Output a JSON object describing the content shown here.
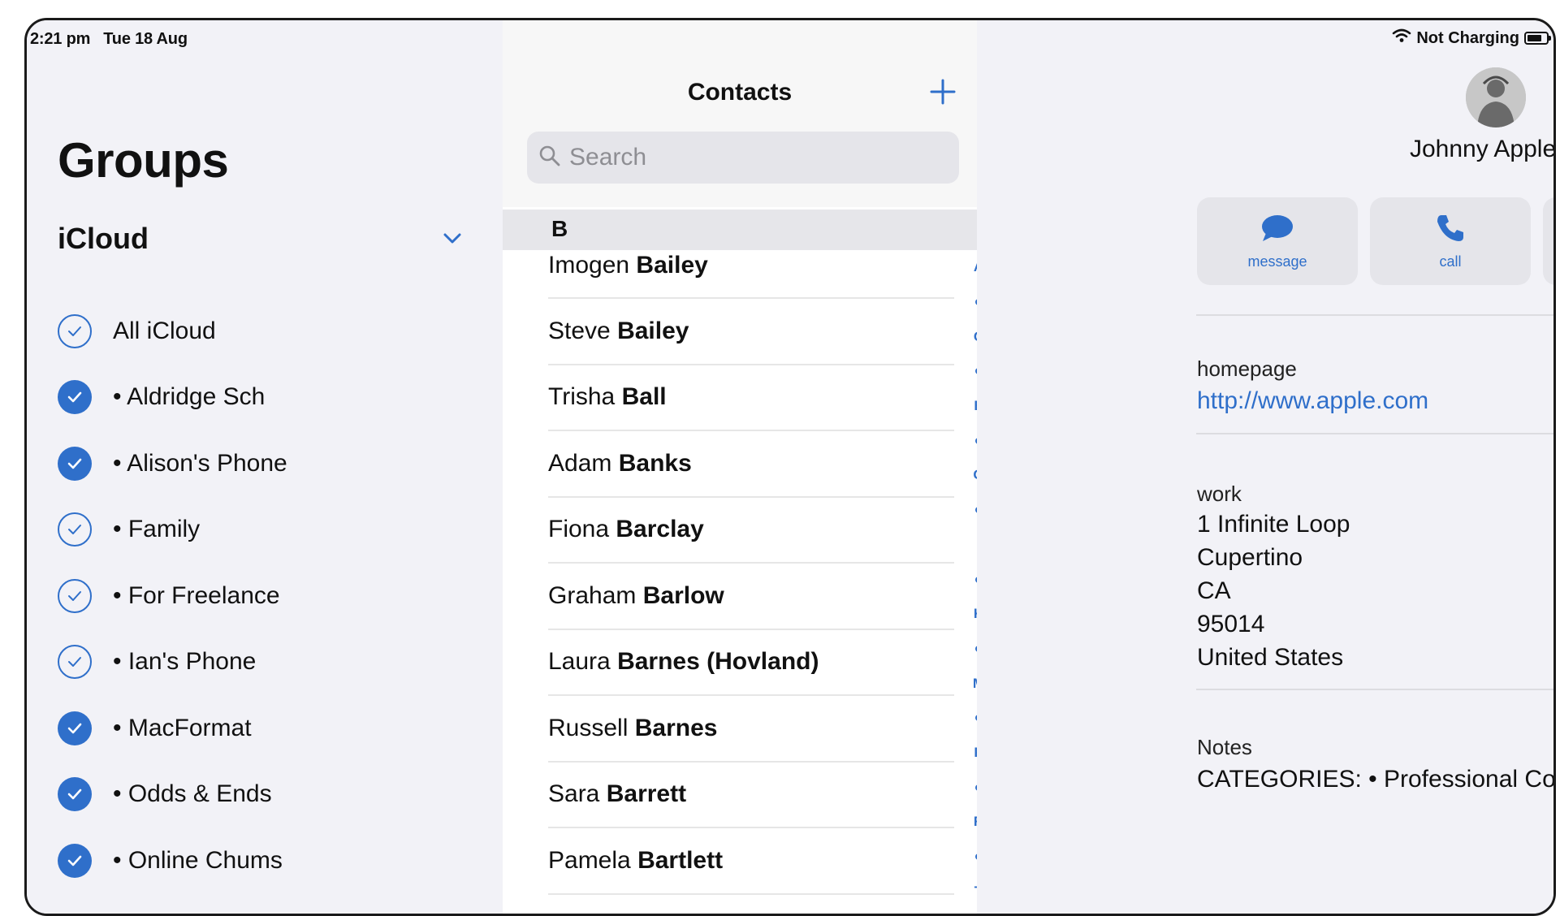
{
  "status_bar": {
    "time": "2:21 pm",
    "date": "Tue 18 Aug",
    "charging": "Not Charging"
  },
  "groups": {
    "title": "Groups",
    "account": "iCloud",
    "items": [
      {
        "label": "All iCloud",
        "checked": false
      },
      {
        "label": "• Aldridge Sch",
        "checked": true
      },
      {
        "label": "• Alison's Phone",
        "checked": true
      },
      {
        "label": "• Family",
        "checked": false
      },
      {
        "label": "• For Freelance",
        "checked": false
      },
      {
        "label": "• Ian's Phone",
        "checked": false
      },
      {
        "label": "• MacFormat",
        "checked": true
      },
      {
        "label": "• Odds & Ends",
        "checked": true
      },
      {
        "label": "• Online Chums",
        "checked": true
      }
    ]
  },
  "contacts": {
    "title": "Contacts",
    "search_placeholder": "Search",
    "section": "B",
    "list": [
      {
        "first": "Imogen",
        "last": "Bailey"
      },
      {
        "first": "Steve",
        "last": "Bailey"
      },
      {
        "first": "Trisha",
        "last": "Ball"
      },
      {
        "first": "Adam",
        "last": "Banks"
      },
      {
        "first": "Fiona",
        "last": "Barclay"
      },
      {
        "first": "Graham",
        "last": "Barlow"
      },
      {
        "first": "Laura",
        "last": "Barnes (Hovland)"
      },
      {
        "first": "Russell",
        "last": "Barnes"
      },
      {
        "first": "Sara",
        "last": "Barrett"
      },
      {
        "first": "Pamela",
        "last": "Bartlett"
      }
    ],
    "index": [
      "A",
      "•",
      "C",
      "•",
      "E",
      "•",
      "G",
      "•",
      "I",
      "•",
      "K",
      "•",
      "M",
      "•",
      "P",
      "•",
      "R",
      "•",
      "T"
    ]
  },
  "detail": {
    "name": "Johnny Apple",
    "actions": {
      "message": "message",
      "call": "call"
    },
    "homepage_label": "homepage",
    "homepage_url": "http://www.apple.com",
    "address_label": "work",
    "address_lines": [
      "1 Infinite Loop",
      "Cupertino",
      "CA",
      "95014",
      "United States"
    ],
    "notes_label": "Notes",
    "notes_value": "CATEGORIES: • Professional Cont"
  },
  "colors": {
    "accent": "#2f6fca",
    "pane_bg": "#f2f2f7"
  }
}
